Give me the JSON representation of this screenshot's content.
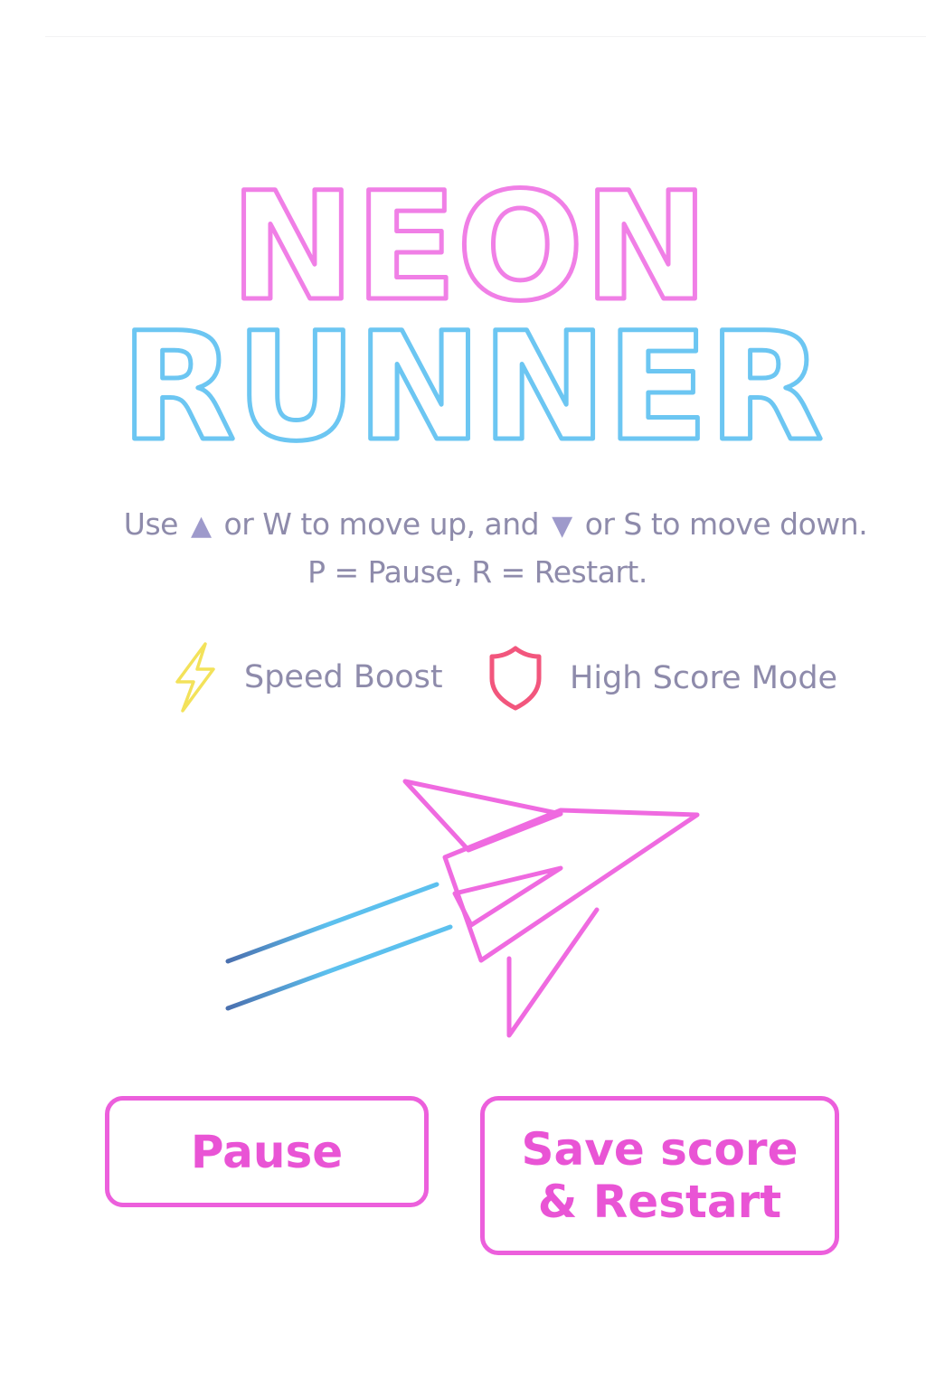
{
  "title": {
    "line1": "NEON",
    "line2": "RUNNER",
    "line1_color": "#f07fe6",
    "line2_color": "#6cc6f2"
  },
  "instructions": {
    "line1_part1": "Use",
    "line1_part2": "or W to move up, and",
    "line1_part3": "or S to move down.",
    "line2": "P = Pause, R = Restart.",
    "up_icon": "up-triangle",
    "down_icon": "down-triangle"
  },
  "modes": {
    "speed_boost": {
      "label": "Speed Boost",
      "icon": "lightning-bolt",
      "color": "#f3e25a"
    },
    "high_score": {
      "label": "High Score Mode",
      "icon": "shield",
      "color": "#f2567d"
    }
  },
  "buttons": {
    "pause": "Pause",
    "save_line1": "Save score",
    "save_line2": "& Restart",
    "accent_color": "#ec5fdc"
  },
  "colors": {
    "text": "#8e8bab",
    "rocket": "#ef6ae0",
    "trail": "#5cc0ee"
  }
}
